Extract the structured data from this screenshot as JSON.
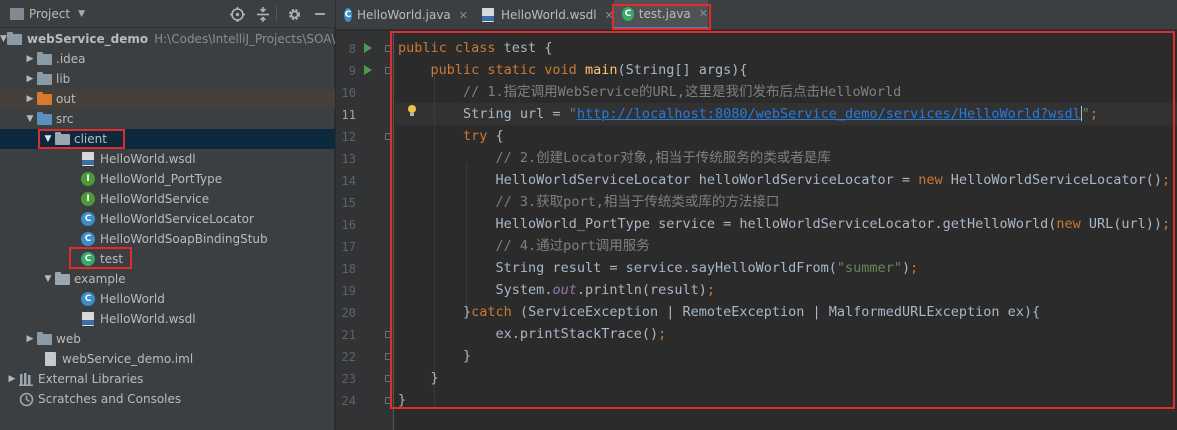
{
  "project_panel": {
    "title": "Project",
    "tree": [
      {
        "label": "webService_demo",
        "path": "H:\\Codes\\IntelliJ_Projects\\SOA\\webService_demo"
      },
      {
        "label": ".idea"
      },
      {
        "label": "lib"
      },
      {
        "label": "out"
      },
      {
        "label": "src"
      },
      {
        "label": "client"
      },
      {
        "label": "HelloWorld.wsdl"
      },
      {
        "label": "HelloWorld_PortType"
      },
      {
        "label": "HelloWorldService"
      },
      {
        "label": "HelloWorldServiceLocator"
      },
      {
        "label": "HelloWorldSoapBindingStub"
      },
      {
        "label": "test"
      },
      {
        "label": "example"
      },
      {
        "label": "HelloWorld"
      },
      {
        "label": "HelloWorld.wsdl"
      },
      {
        "label": "web"
      },
      {
        "label": "webService_demo.iml"
      },
      {
        "label": "External Libraries"
      },
      {
        "label": "Scratches and Consoles"
      }
    ]
  },
  "tabs": [
    {
      "label": "HelloWorld.java",
      "icon": "class-icon"
    },
    {
      "label": "HelloWorld.wsdl",
      "icon": "wsdl-icon"
    },
    {
      "label": "test.java",
      "icon": "class-run-icon",
      "active": true
    }
  ],
  "editor": {
    "line_numbers": [
      "8",
      "9",
      "10",
      "11",
      "12",
      "13",
      "14",
      "15",
      "16",
      "17",
      "18",
      "19",
      "20",
      "21",
      "22",
      "23",
      "24"
    ],
    "current_line": "11",
    "code": {
      "l8_kw": "public class",
      "l8_rest": " test {",
      "l9_kw": "public static void",
      "l9_fn": "main",
      "l9_rest": "(String[] args){",
      "l10_cm": "// 1.指定调用WebService的URL,这里是我们发布后点击HelloWorld",
      "l11_pre": "String url = ",
      "l11_q1": "\"",
      "l11_url": "http://localhost:8080/webService_demo/services/HelloWorld?wsdl",
      "l11_q2": "\"",
      "l11_semi": ";",
      "l12_kw": "try",
      "l12_rest": " {",
      "l13_cm": "// 2.创建Locator对象,相当于传统服务的类或者是库",
      "l14_pre": "HelloWorldServiceLocator helloWorldServiceLocator = ",
      "l14_kw": "new",
      "l14_rest": " HelloWorldServiceLocator()",
      "l14_semi": ";",
      "l15_cm": "// 3.获取port,相当于传统类或库的方法接口",
      "l16_pre": "HelloWorld_PortType service = helloWorldServiceLocator.getHelloWorld(",
      "l16_kw": "new",
      "l16_rest": " URL(url))",
      "l16_semi": ";",
      "l17_cm": "// 4.通过port调用服务",
      "l18_pre": "String result = service.sayHelloWorldFrom(",
      "l18_st": "\"summer\"",
      "l18_rest": ")",
      "l18_semi": ";",
      "l19_pre": "System.",
      "l19_out": "out",
      "l19_rest": ".println(result)",
      "l19_semi": ";",
      "l20_pre": "}",
      "l20_kw": "catch",
      "l20_rest": " (ServiceException | RemoteException | MalformedURLException ex){",
      "l21_pre": "ex.printStackTrace()",
      "l21_semi": ";",
      "l22": "}",
      "l23": "}",
      "l24": "}"
    }
  },
  "colors": {
    "highlight_box": "#e02c2c",
    "keyword": "#cc7832",
    "comment": "#808080",
    "string": "#6a8759",
    "method": "#ffc66d"
  }
}
